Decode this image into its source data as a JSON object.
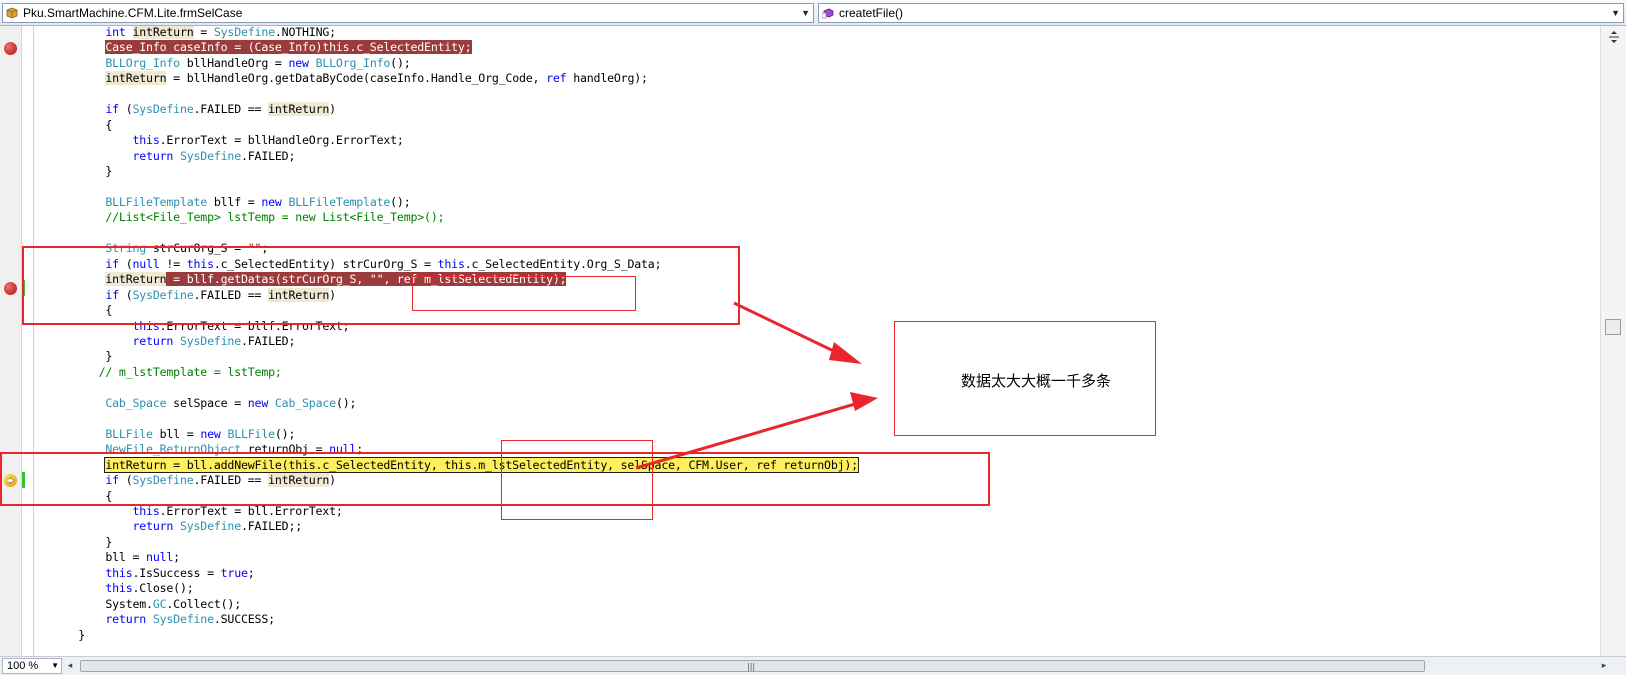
{
  "navigation_bar": {
    "class_selector": "Pku.SmartMachine.CFM.Lite.frmSelCase",
    "member_selector": "createtFile()"
  },
  "code": {
    "lines": [
      [
        [
          "",
          "            "
        ],
        [
          "kw",
          "int"
        ],
        [
          "",
          " "
        ],
        [
          "hl",
          "intReturn"
        ],
        [
          "",
          " = "
        ],
        [
          "ty",
          "SysDefine"
        ],
        [
          "",
          ".NOTHING;"
        ]
      ],
      [
        [
          "",
          "            "
        ],
        [
          "bp",
          "Case_Info caseInfo = (Case_Info)this.c_SelectedEntity;"
        ]
      ],
      [
        [
          "",
          "            "
        ],
        [
          "ty",
          "BLLOrg_Info"
        ],
        [
          "",
          " bllHandleOrg = "
        ],
        [
          "kw",
          "new"
        ],
        [
          "",
          " "
        ],
        [
          "ty",
          "BLLOrg_Info"
        ],
        [
          "",
          "();"
        ]
      ],
      [
        [
          "",
          "            "
        ],
        [
          "hl",
          "intReturn"
        ],
        [
          "",
          " = bllHandleOrg.getDataByCode(caseInfo.Handle_Org_Code, "
        ],
        [
          "kw",
          "ref"
        ],
        [
          "",
          " handleOrg);"
        ]
      ],
      [],
      [
        [
          "",
          "            "
        ],
        [
          "kw",
          "if"
        ],
        [
          "",
          " ("
        ],
        [
          "ty",
          "SysDefine"
        ],
        [
          "",
          ".FAILED == "
        ],
        [
          "hl",
          "intReturn"
        ],
        [
          "",
          ")"
        ]
      ],
      [
        [
          "",
          "            {"
        ]
      ],
      [
        [
          "",
          "                "
        ],
        [
          "kw",
          "this"
        ],
        [
          "",
          ".ErrorText = bllHandleOrg.ErrorText;"
        ]
      ],
      [
        [
          "",
          "                "
        ],
        [
          "kw",
          "return"
        ],
        [
          "",
          " "
        ],
        [
          "ty",
          "SysDefine"
        ],
        [
          "",
          ".FAILED;"
        ]
      ],
      [
        [
          "",
          "            }"
        ]
      ],
      [],
      [
        [
          "",
          "            "
        ],
        [
          "ty",
          "BLLFileTemplate"
        ],
        [
          "",
          " bllf = "
        ],
        [
          "kw",
          "new"
        ],
        [
          "",
          " "
        ],
        [
          "ty",
          "BLLFileTemplate"
        ],
        [
          "",
          "();"
        ]
      ],
      [
        [
          "",
          "            "
        ],
        [
          "cm",
          "//List<File_Temp> lstTemp = new List<File_Temp>();"
        ]
      ],
      [],
      [
        [
          "",
          "            "
        ],
        [
          "ty",
          "String"
        ],
        [
          "",
          " strCurOrg_S = "
        ],
        [
          "st",
          "\"\""
        ],
        [
          "",
          ";"
        ]
      ],
      [
        [
          "",
          "            "
        ],
        [
          "kw",
          "if"
        ],
        [
          "",
          " ("
        ],
        [
          "kw",
          "null"
        ],
        [
          "",
          " != "
        ],
        [
          "kw",
          "this"
        ],
        [
          "",
          ".c_SelectedEntity) strCurOrg_S = "
        ],
        [
          "kw",
          "this"
        ],
        [
          "",
          ".c_SelectedEntity.Org_S_Data;"
        ]
      ],
      [
        [
          "",
          "            "
        ],
        [
          "hl",
          "intReturn"
        ],
        [
          "bp",
          " = bllf.getDatas(strCurOrg_S, \"\", ref m_lstSelectedEntity);"
        ]
      ],
      [
        [
          "",
          "            "
        ],
        [
          "kw",
          "if"
        ],
        [
          "",
          " ("
        ],
        [
          "ty",
          "SysDefine"
        ],
        [
          "",
          ".FAILED == "
        ],
        [
          "hl",
          "intReturn"
        ],
        [
          "",
          ")"
        ]
      ],
      [
        [
          "",
          "            {"
        ]
      ],
      [
        [
          "",
          "                "
        ],
        [
          "kw",
          "this"
        ],
        [
          "",
          ".ErrorText = bllf.ErrorText;"
        ]
      ],
      [
        [
          "",
          "                "
        ],
        [
          "kw",
          "return"
        ],
        [
          "",
          " "
        ],
        [
          "ty",
          "SysDefine"
        ],
        [
          "",
          ".FAILED;"
        ]
      ],
      [
        [
          "",
          "            }"
        ]
      ],
      [
        [
          "",
          "           "
        ],
        [
          "cm",
          "// m_lstTemplate = lstTemp;"
        ]
      ],
      [],
      [
        [
          "",
          "            "
        ],
        [
          "ty",
          "Cab_Space"
        ],
        [
          "",
          " selSpace = "
        ],
        [
          "kw",
          "new"
        ],
        [
          "",
          " "
        ],
        [
          "ty",
          "Cab_Space"
        ],
        [
          "",
          "();"
        ]
      ],
      [],
      [
        [
          "",
          "            "
        ],
        [
          "ty",
          "BLLFile"
        ],
        [
          "",
          " bll = "
        ],
        [
          "kw",
          "new"
        ],
        [
          "",
          " "
        ],
        [
          "ty",
          "BLLFile"
        ],
        [
          "",
          "();"
        ]
      ],
      [
        [
          "",
          "            "
        ],
        [
          "ty",
          "NewFile_ReturnObject"
        ],
        [
          "",
          " returnObj = "
        ],
        [
          "kw",
          "null"
        ],
        [
          "",
          ";"
        ]
      ],
      [
        [
          "",
          "            "
        ],
        [
          "cur",
          "intReturn = bll.addNewFile(this.c_SelectedEntity, this.m_lstSelectedEntity, selSpace, CFM.User, ref returnObj);"
        ]
      ],
      [
        [
          "",
          "            "
        ],
        [
          "kw",
          "if"
        ],
        [
          "",
          " ("
        ],
        [
          "ty",
          "SysDefine"
        ],
        [
          "",
          ".FAILED == "
        ],
        [
          "hl",
          "intReturn"
        ],
        [
          "",
          ")"
        ]
      ],
      [
        [
          "",
          "            {"
        ]
      ],
      [
        [
          "",
          "                "
        ],
        [
          "kw",
          "this"
        ],
        [
          "",
          ".ErrorText = bll.ErrorText;"
        ]
      ],
      [
        [
          "",
          "                "
        ],
        [
          "kw",
          "return"
        ],
        [
          "",
          " "
        ],
        [
          "ty",
          "SysDefine"
        ],
        [
          "",
          ".FAILED;;"
        ]
      ],
      [
        [
          "",
          "            }"
        ]
      ],
      [
        [
          "",
          "            bll = "
        ],
        [
          "kw",
          "null"
        ],
        [
          "",
          ";"
        ]
      ],
      [
        [
          "",
          "            "
        ],
        [
          "kw",
          "this"
        ],
        [
          "",
          ".IsSuccess = "
        ],
        [
          "kw",
          "true"
        ],
        [
          "",
          ";"
        ]
      ],
      [
        [
          "",
          "            "
        ],
        [
          "kw",
          "this"
        ],
        [
          "",
          ".Close();"
        ]
      ],
      [
        [
          "",
          "            System."
        ],
        [
          "ty",
          "GC"
        ],
        [
          "",
          ".Collect();"
        ]
      ],
      [
        [
          "",
          "            "
        ],
        [
          "kw",
          "return"
        ],
        [
          "",
          " "
        ],
        [
          "ty",
          "SysDefine"
        ],
        [
          "",
          ".SUCCESS;"
        ]
      ],
      [
        [
          "",
          "        }"
        ]
      ]
    ]
  },
  "annotation": {
    "text": "数据太大大概一千多条"
  },
  "status": {
    "zoom": "100 %"
  },
  "colors": {
    "keyword": "#0000ff",
    "type": "#2b91af",
    "comment": "#008000",
    "breakpoint_highlight": "#9b3b3b",
    "current_statement": "#ffef5c",
    "annotation_red": "#e8262b"
  }
}
